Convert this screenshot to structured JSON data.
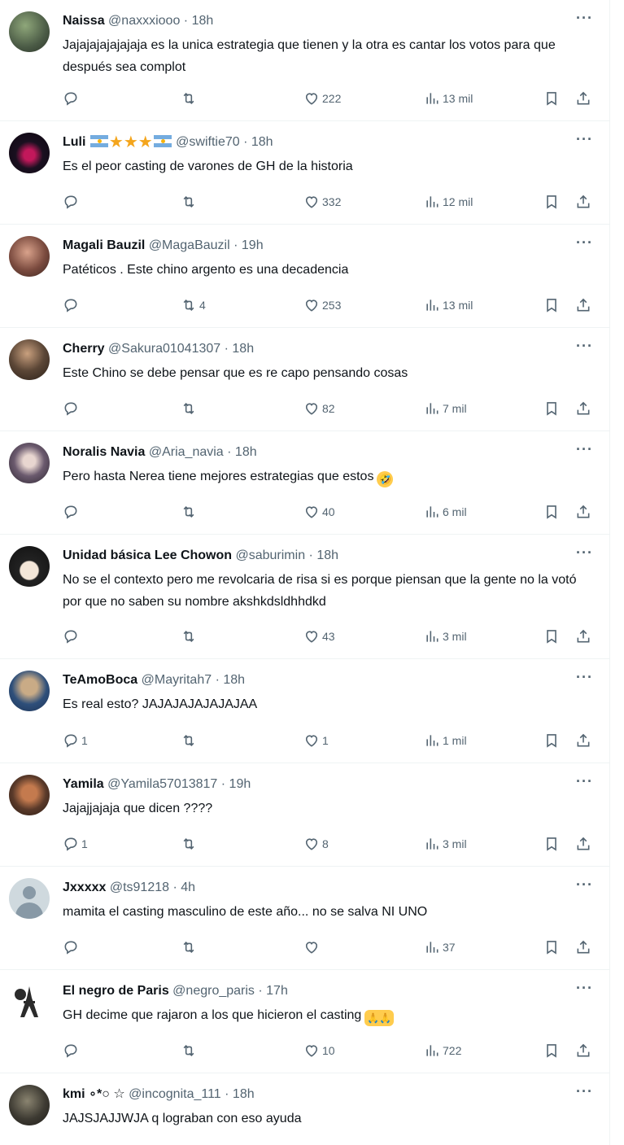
{
  "feed": {
    "more_label": "···",
    "tweets": [
      {
        "name": "Naissa",
        "handle": "@naxxxiooo",
        "time": "18h",
        "text": "Jajajajajajajaja es la unica estrategia que tienen y la otra es cantar los votos para que después sea complot",
        "replies": "",
        "retweets": "",
        "likes": "222",
        "views": "13 mil",
        "avatar_color": "#4a5a45"
      },
      {
        "name": "Luli",
        "name_decor": "★★★",
        "handle": "@swiftie70",
        "time": "18h",
        "text": "Es el peor casting de varones de GH de la historia",
        "replies": "",
        "retweets": "",
        "likes": "332",
        "views": "12 mil",
        "avatar_color": "#1a1020"
      },
      {
        "name": "Magali Bauzil",
        "handle": "@MagaBauzil",
        "time": "19h",
        "text": "Patéticos . Este chino argento es una decadencia",
        "replies": "",
        "retweets": "4",
        "likes": "253",
        "views": "13 mil",
        "avatar_color": "#7a4a3e"
      },
      {
        "name": "Cherry",
        "handle": "@Sakura01041307",
        "time": "18h",
        "text": "Este Chino se debe pensar que es re capo pensando cosas",
        "replies": "",
        "retweets": "",
        "likes": "82",
        "views": "7 mil",
        "avatar_color": "#5b4636"
      },
      {
        "name": "Noralis Navia",
        "handle": "@Aria_navia",
        "time": "18h",
        "text": "Pero hasta Nerea tiene mejores estrategias que estos",
        "emoji": "🤣",
        "replies": "",
        "retweets": "",
        "likes": "40",
        "views": "6 mil",
        "avatar_color": "#6b5a6e"
      },
      {
        "name": "Unidad básica Lee Chowon",
        "handle": "@saburimin",
        "time": "18h",
        "text": "No se el contexto pero me revolcaria de risa si es porque piensan que la gente no la votó por que no saben su nombre akshkdsldhhdkd",
        "replies": "",
        "retweets": "",
        "likes": "43",
        "views": "3 mil",
        "avatar_color": "#222222"
      },
      {
        "name": "TeAmoBoca",
        "handle": "@Mayritah7",
        "time": "18h",
        "text": "Es real esto? JAJAJAJAJAJAJAA",
        "replies": "1",
        "retweets": "",
        "likes": "1",
        "views": "1 mil",
        "avatar_color": "#2e4f7a"
      },
      {
        "name": "Yamila",
        "handle": "@Yamila57013817",
        "time": "19h",
        "text": "Jajajjajaja que dicen ????",
        "replies": "1",
        "retweets": "",
        "likes": "8",
        "views": "3 mil",
        "avatar_color": "#5a3a2a"
      },
      {
        "name": "Jxxxxx",
        "handle": "@ts91218",
        "time": "4h",
        "text": "mamita el casting masculino de este año... no se salva NI UNO",
        "replies": "",
        "retweets": "",
        "likes": "",
        "views": "37",
        "avatar_color": "#cfd9de"
      },
      {
        "name": "El negro de Paris",
        "handle": "@negro_paris",
        "time": "17h",
        "text": "GH decime que  rajaron a los que hicieron el casting",
        "emoji": "🙏🙏",
        "replies": "",
        "retweets": "",
        "likes": "10",
        "views": "722",
        "avatar_color": "#2b2b2b"
      },
      {
        "name": "kmi ∘*○ ☆",
        "handle": "@incognita_111",
        "time": "18h",
        "text": "JAJSJAJJWJA q lograban con eso ayuda",
        "replies": "",
        "retweets": "",
        "likes": "",
        "views": "",
        "avatar_color": "#3d3a32"
      }
    ]
  }
}
